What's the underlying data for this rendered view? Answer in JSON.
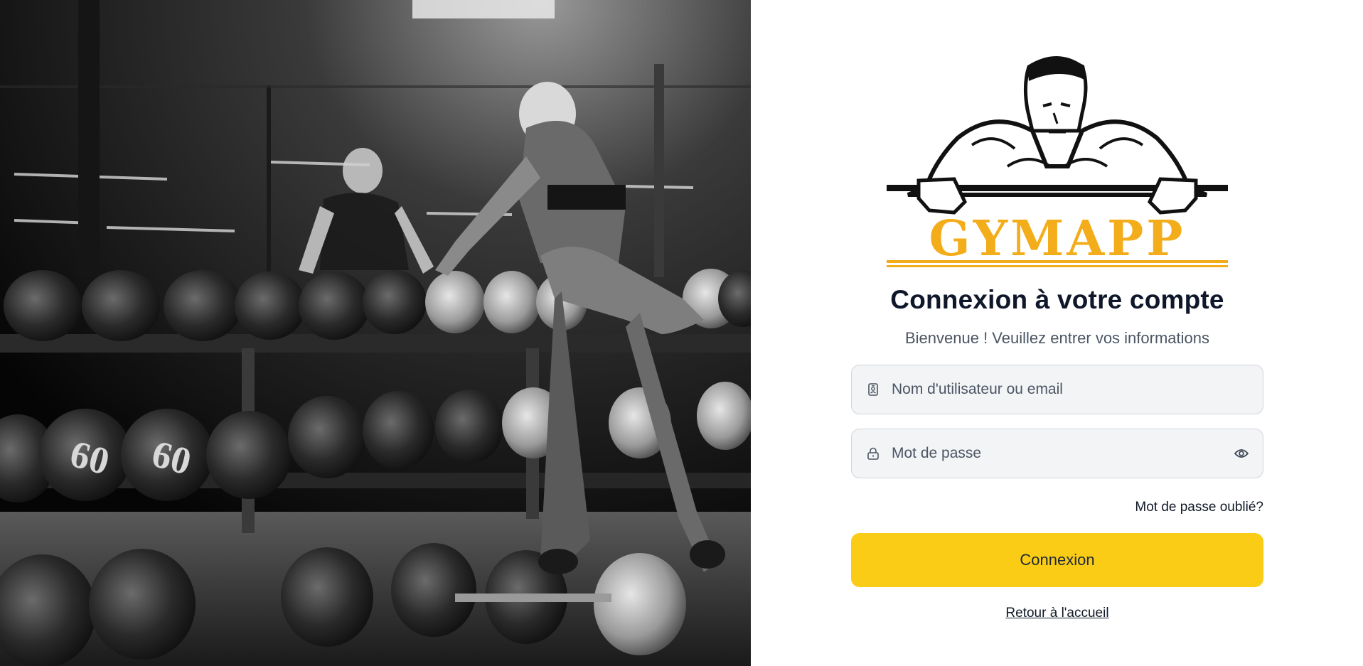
{
  "photo": {
    "alt_icon": "gym-photo"
  },
  "brand": {
    "name": "GYMAPP",
    "accent": "#f4ad1a"
  },
  "login": {
    "title": "Connexion à votre compte",
    "subtitle": "Bienvenue ! Veuillez entrer vos informations",
    "username_placeholder": "Nom d'utilisateur ou email",
    "password_placeholder": "Mot de passe",
    "forgot_label": "Mot de passe oublié?",
    "submit_label": "Connexion",
    "back_label": "Retour à l'accueil"
  },
  "colors": {
    "button": "#facc15",
    "field_bg": "#f3f4f6",
    "field_border": "#d1d5db",
    "title": "#0f172a"
  },
  "icons": {
    "username": "id-badge-icon",
    "password": "lock-icon",
    "toggle": "eye-icon"
  }
}
